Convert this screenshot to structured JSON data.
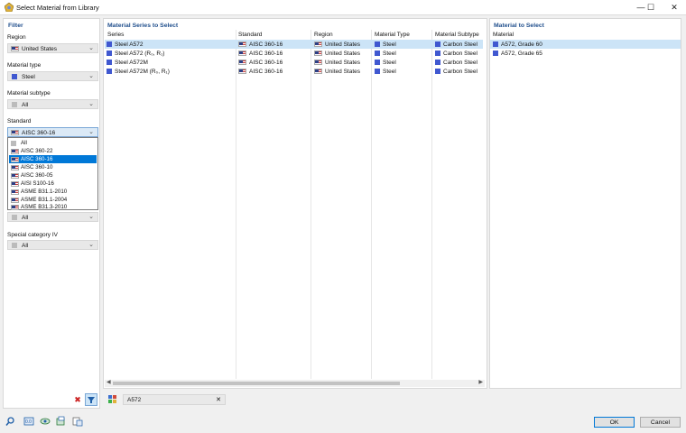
{
  "window": {
    "title": "Select Material from Library",
    "minimize": "—",
    "maximize": "☐",
    "close": "✕"
  },
  "filter": {
    "title": "Filter",
    "region": {
      "label": "Region",
      "value": "United States"
    },
    "material_type": {
      "label": "Material type",
      "value": "Steel"
    },
    "material_subtype": {
      "label": "Material subtype",
      "value": "All"
    },
    "standard": {
      "label": "Standard",
      "value": "AISC 360-16",
      "options": [
        "All",
        "AISC 360-22",
        "AISC 360-16",
        "AISC 360-10",
        "AISC 360-05",
        "AISI S100-16",
        "ASME B31.1-2010",
        "ASME B31.1-2004",
        "ASME B31.3-2010"
      ],
      "selected_index": 2
    },
    "hidden_combo": {
      "value": "All"
    },
    "special_category": {
      "label": "Special category IV",
      "value": "All"
    }
  },
  "series_panel": {
    "title": "Material Series to Select",
    "columns": [
      "Series",
      "Standard",
      "Region",
      "Material Type",
      "Material Subtype"
    ],
    "rows": [
      {
        "series": "Steel A572",
        "standard": "AISC 360-16",
        "region": "United States",
        "type": "Steel",
        "subtype": "Carbon Steel"
      },
      {
        "series": "Steel A572 (R₀, R₁)",
        "standard": "AISC 360-16",
        "region": "United States",
        "type": "Steel",
        "subtype": "Carbon Steel"
      },
      {
        "series": "Steel A572M",
        "standard": "AISC 360-16",
        "region": "United States",
        "type": "Steel",
        "subtype": "Carbon Steel"
      },
      {
        "series": "Steel A572M (R₀, R₁)",
        "standard": "AISC 360-16",
        "region": "United States",
        "type": "Steel",
        "subtype": "Carbon Steel"
      }
    ],
    "search_value": "A572",
    "search_clear": "✕"
  },
  "material_panel": {
    "title": "Material to Select",
    "column": "Material",
    "items": [
      "A572, Grade 60",
      "A572, Grade 65"
    ]
  },
  "buttons": {
    "ok": "OK",
    "cancel": "Cancel"
  },
  "colors": {
    "accent": "#0078d7",
    "selected_row": "#cce4f7",
    "panel_title": "#1f4e8c",
    "material_square": "#4058d0"
  }
}
